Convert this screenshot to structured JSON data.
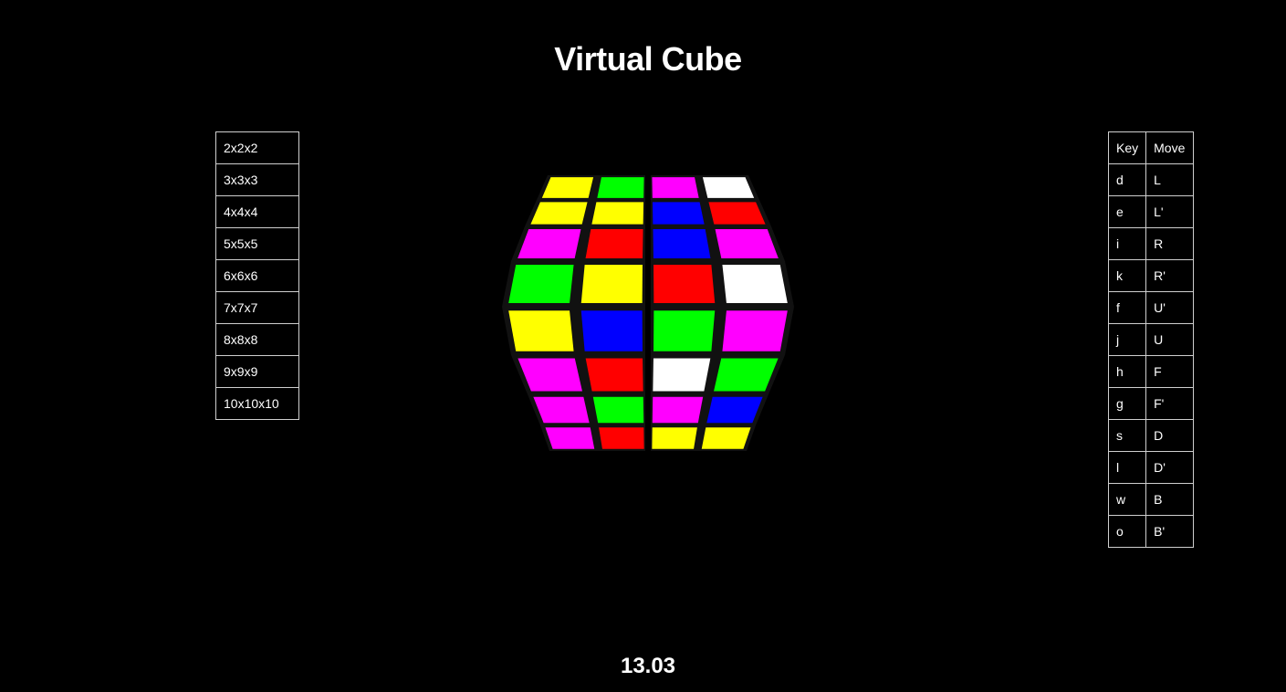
{
  "title": "Virtual Cube",
  "timer": "13.03",
  "cube_sizes": [
    "2x2x2",
    "3x3x3",
    "4x4x4",
    "5x5x5",
    "6x6x6",
    "7x7x7",
    "8x8x8",
    "9x9x9",
    "10x10x10"
  ],
  "key_table": {
    "header_key": "Key",
    "header_move": "Move",
    "rows": [
      {
        "key": "d",
        "move": "L"
      },
      {
        "key": "e",
        "move": "L'"
      },
      {
        "key": "i",
        "move": "R"
      },
      {
        "key": "k",
        "move": "R'"
      },
      {
        "key": "f",
        "move": "U'"
      },
      {
        "key": "j",
        "move": "U"
      },
      {
        "key": "h",
        "move": "F"
      },
      {
        "key": "g",
        "move": "F'"
      },
      {
        "key": "s",
        "move": "D"
      },
      {
        "key": "l",
        "move": "D'"
      },
      {
        "key": "w",
        "move": "B"
      },
      {
        "key": "o",
        "move": "B'"
      }
    ]
  },
  "cube": {
    "sticker_colors": {
      "Y": "#ffff00",
      "G": "#00ff00",
      "M": "#ff00ff",
      "W": "#ffffff",
      "B": "#0000ff",
      "R": "#ff0000"
    },
    "facelets": [
      [
        "Y",
        "G",
        "M",
        "W"
      ],
      [
        "Y",
        "Y",
        "B",
        "R"
      ],
      [
        "M",
        "R",
        "B",
        "M"
      ],
      [
        "G",
        "Y",
        "R",
        "W"
      ],
      [
        "Y",
        "B",
        "G",
        "M"
      ],
      [
        "M",
        "R",
        "W",
        "G"
      ],
      [
        "M",
        "G",
        "M",
        "B"
      ],
      [
        "M",
        "R",
        "Y",
        "Y"
      ]
    ]
  }
}
